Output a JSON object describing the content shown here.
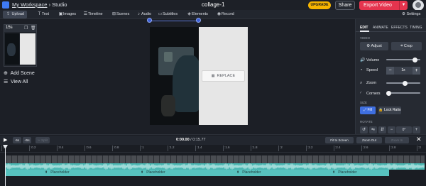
{
  "header": {
    "workspace": "My Workspace",
    "separator": "›",
    "section": "Studio",
    "project_title": "collage-1",
    "upgrade_label": "UPGRADE",
    "share_label": "Share",
    "export_label": "Export Video",
    "accent_color": "#e5344e",
    "upgrade_color": "#f6b400"
  },
  "toolbar": {
    "upload": "Upload",
    "text": "Text",
    "images": "Images",
    "timeline": "Timeline",
    "scenes": "Scenes",
    "audio": "Audio",
    "subtitles": "Subtitles",
    "elements": "Elements",
    "record": "Record",
    "settings": "Settings"
  },
  "scenes_panel": {
    "scene_duration": "15s",
    "add_scene": "Add Scene",
    "view_all": "View All"
  },
  "canvas": {
    "replace_label": "REPLACE"
  },
  "right_panel": {
    "tabs": [
      "EDIT",
      "ANIMATE",
      "EFFECTS",
      "TIMING"
    ],
    "active_tab": "EDIT",
    "video_section": "VIDEO",
    "adjust_label": "Adjust",
    "crop_label": "Crop",
    "volume_label": "Volume",
    "volume_level": 0.9,
    "speed_label": "Speed",
    "speed_value": "1x",
    "zoom_label": "Zoom",
    "zoom_level": 0.55,
    "corners_label": "Corners",
    "corners_level": 0.0,
    "size_section": "SIZE",
    "fill_label": "Fill",
    "lock_ratio_label": "Lock Ratio",
    "rotate_section": "ROTATE",
    "rotate_value": "0°"
  },
  "timeline": {
    "back_label": "-5s",
    "fwd_label": "+5s",
    "split_label": "Split",
    "current_time": "0:00.00",
    "total_time": "0:15.77",
    "fit_label": "Fit to Screen",
    "zoom_out_label": "Zoom Out",
    "zoom_in_label": "Zoom In",
    "ruler_ticks": [
      ":0",
      ":0.2",
      ":0.4",
      ":0.6",
      ":0.8",
      ":1",
      ":1.2",
      ":1.4",
      ":1.6",
      ":1.8",
      ":2",
      ":2.2",
      ":2.4",
      ":2.6",
      ":2.8",
      ":3"
    ],
    "placeholders": [
      "Placeholder",
      "Placeholder",
      "Placeholder",
      "Placeholder"
    ]
  }
}
